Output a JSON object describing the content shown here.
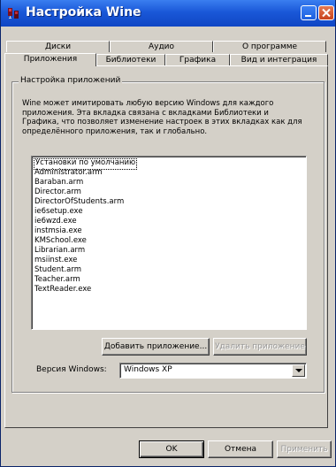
{
  "window": {
    "title": "Настройка Wine"
  },
  "tabs": {
    "row1": [
      "Диски",
      "Аудио",
      "О программе"
    ],
    "row2": [
      "Приложения",
      "Библиотеки",
      "Графика",
      "Вид и интеграция"
    ],
    "selected": "Приложения"
  },
  "group": {
    "title": "Настройка приложений",
    "description": "Wine может имитировать любую версию Windows для каждого приложения. Эта вкладка связана с вкладками Библиотеки и Графика, что позволяет изменение настроек в этих вкладках как для определённого приложения, так и глобально."
  },
  "apps": [
    "Установки по умолчанию",
    "Administrator.arm",
    "Baraban.arm",
    "Director.arm",
    "DirectorOfStudents.arm",
    "ie6setup.exe",
    "ie6wzd.exe",
    "instmsia.exe",
    "KMSchool.exe",
    "Librarian.arm",
    "msiinst.exe",
    "Student.arm",
    "Teacher.arm",
    "TextReader.exe"
  ],
  "buttons": {
    "add_app": "Добавить приложение...",
    "remove_app": "Удалить приложение",
    "ok": "OK",
    "cancel": "Отмена",
    "apply": "Применить"
  },
  "version": {
    "label": "Версия Windows:",
    "value": "Windows XP"
  },
  "icons": {
    "app": "wine-glass-icon",
    "minimize": "minimize-icon",
    "close": "close-icon",
    "dropdown": "chevron-down-icon"
  }
}
